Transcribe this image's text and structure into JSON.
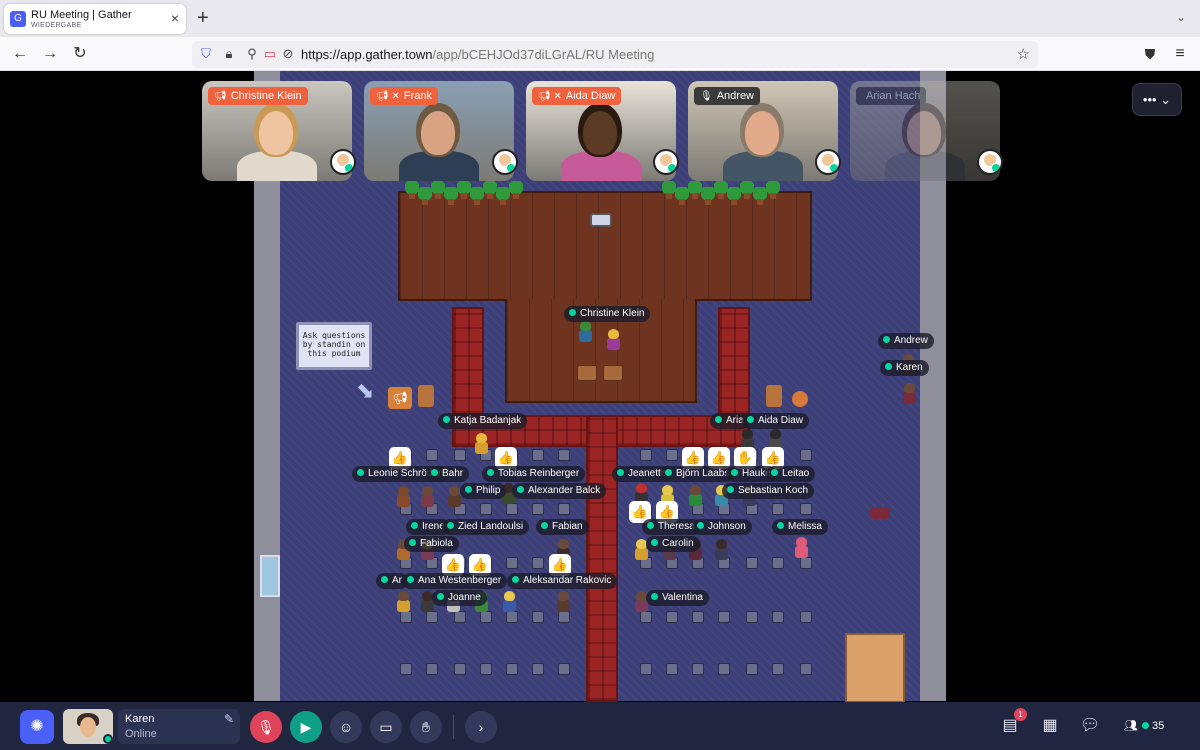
{
  "browser": {
    "tab_title": "RU Meeting | Gather",
    "tab_subtitle": "WIEDERGABE",
    "tab_close": "×",
    "new_tab": "+",
    "url_host": "https://app.gather.town",
    "url_path": "/app/bCEHJOd37diLGrAL/RU Meeting"
  },
  "video_tiles": [
    {
      "name": "Christine Klein",
      "label_color": "#f0623d",
      "icon": "megaphone-icon"
    },
    {
      "name": "Frank",
      "label_color": "#f0623d",
      "icon": "megaphone-muted-icon"
    },
    {
      "name": "Aida Diaw",
      "label_color": "#f0623d",
      "icon": "megaphone-muted-icon"
    },
    {
      "name": "Andrew",
      "label_color": "#3a3a3a",
      "icon": "mic-muted-icon"
    },
    {
      "name": "Arian Hach",
      "label_color": "#3a3a3a",
      "icon": "none"
    }
  ],
  "more_button": "•••",
  "map": {
    "sign_text": "Ask questions by standin on this podium",
    "name_tags": [
      "Christine Klein",
      "Andrew",
      "Karen",
      "Katja Badanjak",
      "Aria",
      "Aida Diaw",
      "Leonie Schröder",
      "Bahr",
      "Tobias Reinberger",
      "Jeanette",
      "Björn Laabs",
      "Hauke",
      "Leitao",
      "Philip",
      "Alexander Balck",
      "Sebastian Koch",
      "Irene",
      "Zied Landoulsi",
      "Fabian",
      "Theresa",
      "Johnson",
      "Melissa",
      "Fabiola",
      "Carolin",
      "Ar",
      "Ana Westenberger",
      "Aleksandar Rakovic",
      "Joanne",
      "Valentina"
    ],
    "thumbs_emoji": "👍",
    "hand_emoji": "✋"
  },
  "bottom_bar": {
    "user_name": "Karen",
    "user_status": "Online",
    "notification_count": "1",
    "participant_count": "35"
  },
  "colors": {
    "online": "#06d6a0",
    "mic_off": "#e0445a",
    "camera_on": "#0f9e86",
    "gather_blue": "#4a5ff5"
  }
}
